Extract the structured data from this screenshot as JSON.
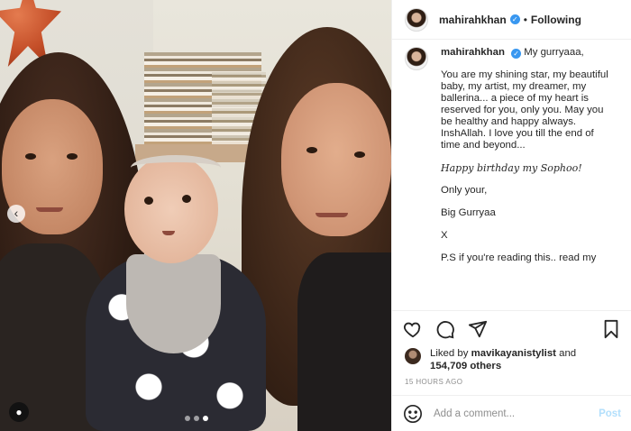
{
  "post": {
    "username": "mahirahkhan",
    "verified_mark": "✓",
    "separator": "•",
    "follow_state": "Following"
  },
  "photo": {
    "carousel_prev_glyph": "‹",
    "tag_glyph": "●",
    "slide_count": 3,
    "active_slide": 3
  },
  "caption": {
    "first_line": "My gurryaaa,",
    "paragraph_1": "You are my shining star, my beautiful baby, my artist, my dreamer, my ballerina... a piece of my heart is reserved for you, only you. May you be healthy and happy always. InshAllah. I love you till the end of time and beyond...",
    "italic_line": "Happy birthday my Sophoo!",
    "line_only_your": "Only your,",
    "line_big": "Big Gurryaa",
    "line_x": "X",
    "line_ps": "P.S if you're reading this.. read my"
  },
  "likes": {
    "prefix": "Liked by",
    "liker": "mavikayanistylist",
    "connector": "and",
    "count": "154,709 others"
  },
  "timestamp": "15 HOURS AGO",
  "comment": {
    "placeholder": "Add a comment...",
    "post_label": "Post"
  },
  "icons": {
    "like": "heart-icon",
    "comment": "comment-icon",
    "share": "share-icon",
    "save": "bookmark-icon",
    "emoji": "emoji-icon"
  },
  "colors": {
    "verified": "#3897f0",
    "post_button": "#b2dffc",
    "muted": "#8e8e8e"
  }
}
